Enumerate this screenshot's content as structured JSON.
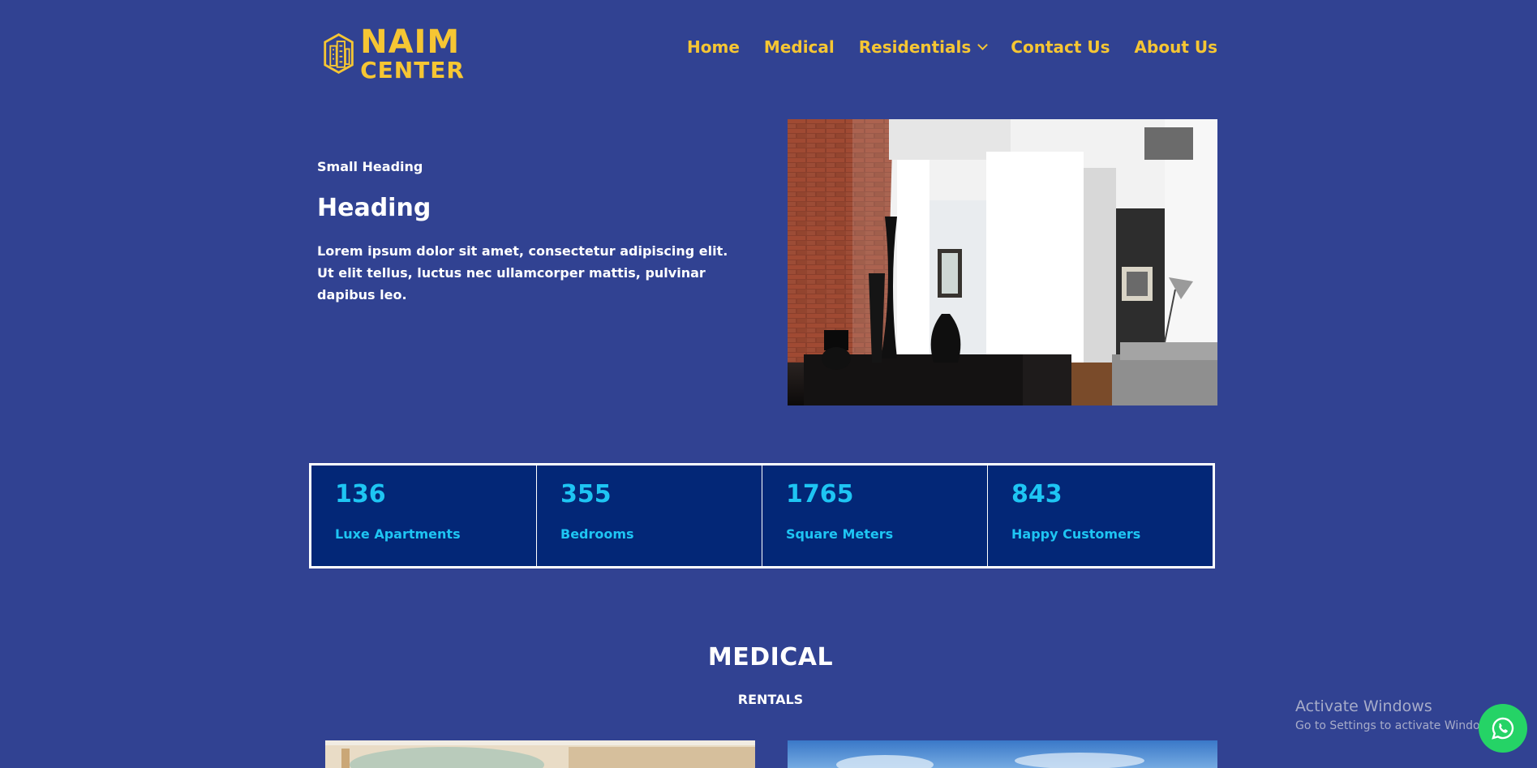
{
  "header": {
    "logo": {
      "line1": "NAIM",
      "line2": "CENTER"
    },
    "nav": [
      {
        "label": "Home"
      },
      {
        "label": "Medical"
      },
      {
        "label": "Residentials",
        "has_dropdown": true
      },
      {
        "label": "Contact Us"
      },
      {
        "label": "About Us"
      }
    ]
  },
  "hero": {
    "small_heading": "Small Heading",
    "heading": "Heading",
    "body": "Lorem ipsum dolor sit amet, consectetur adipiscing elit. Ut elit tellus, luctus nec ullamcorper mattis, pulvinar dapibus leo."
  },
  "stats": [
    {
      "value": "136",
      "label": "Luxe Apartments"
    },
    {
      "value": "355",
      "label": "Bedrooms"
    },
    {
      "value": "1765",
      "label": "Square Meters"
    },
    {
      "value": "843",
      "label": "Happy Customers"
    }
  ],
  "medical": {
    "title": "MEDICAL",
    "subtitle": "RENTALS"
  },
  "watermark": {
    "title": "Activate Windows",
    "subtitle": "Go to Settings to activate Windows."
  },
  "colors": {
    "background": "#314292",
    "accent": "#f6c633",
    "stat_text": "#1ec5f3",
    "stat_bg": "#032777",
    "whatsapp": "#25d366"
  },
  "icons": {
    "whatsapp": "whatsapp-icon",
    "logo": "building-hexagon-icon"
  }
}
